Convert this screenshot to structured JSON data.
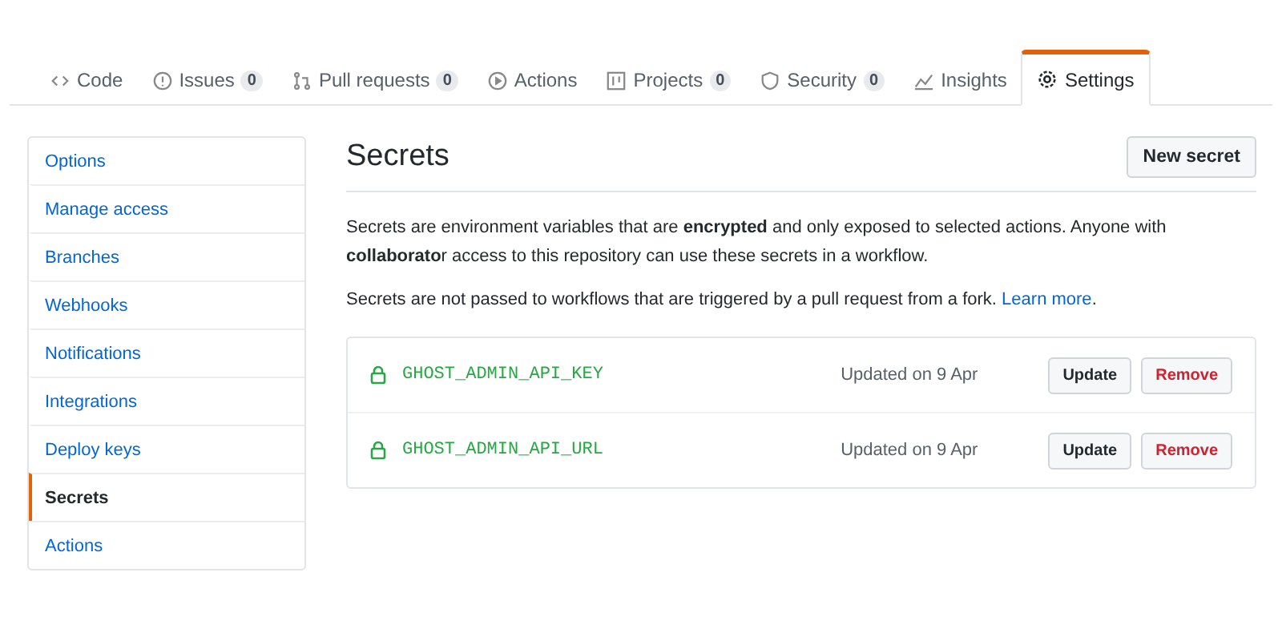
{
  "tabs": [
    {
      "label": "Code",
      "selected": false
    },
    {
      "label": "Issues",
      "count": "0",
      "selected": false
    },
    {
      "label": "Pull requests",
      "count": "0",
      "selected": false
    },
    {
      "label": "Actions",
      "selected": false
    },
    {
      "label": "Projects",
      "count": "0",
      "selected": false
    },
    {
      "label": "Security",
      "count": "0",
      "selected": false
    },
    {
      "label": "Insights",
      "selected": false
    },
    {
      "label": "Settings",
      "selected": true
    }
  ],
  "sidebar": {
    "items": [
      {
        "label": "Options",
        "selected": false
      },
      {
        "label": "Manage access",
        "selected": false
      },
      {
        "label": "Branches",
        "selected": false
      },
      {
        "label": "Webhooks",
        "selected": false
      },
      {
        "label": "Notifications",
        "selected": false
      },
      {
        "label": "Integrations",
        "selected": false
      },
      {
        "label": "Deploy keys",
        "selected": false
      },
      {
        "label": "Secrets",
        "selected": true
      },
      {
        "label": "Actions",
        "selected": false
      }
    ]
  },
  "heading": "Secrets",
  "new_button": "New secret",
  "description": "Secrets are environment variables that are **encrypted** and only exposed to selected actions. Anyone with **collaborato**r access to this repository can use these secrets in a workflow.",
  "note": "Secrets are not passed to workflows that are triggered by a pull request from a fork.",
  "note_link": "Learn more",
  "note_end": ".",
  "secrets": [
    {
      "name": "GHOST_ADMIN_API_KEY",
      "updated": "Updated on 9 Apr",
      "update": "Update",
      "remove": "Remove"
    },
    {
      "name": "GHOST_ADMIN_API_URL",
      "updated": "Updated on 9 Apr",
      "update": "Update",
      "remove": "Remove"
    }
  ]
}
